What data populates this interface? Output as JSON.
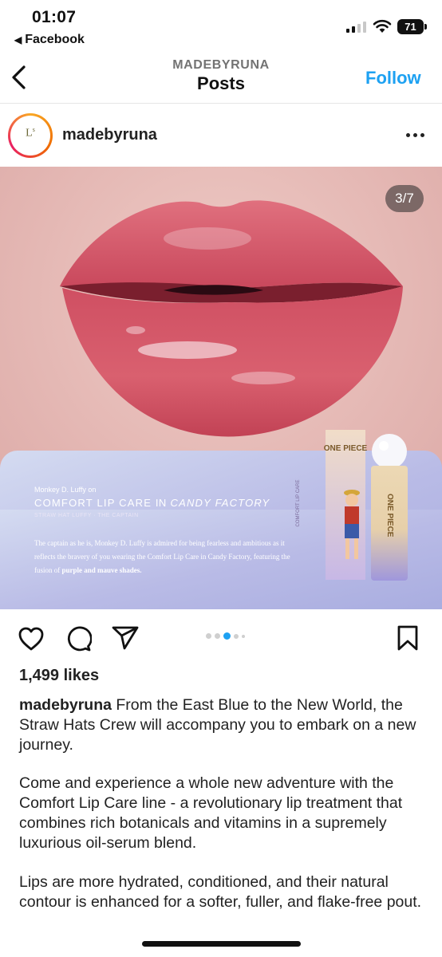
{
  "status_bar": {
    "time": "01:07",
    "back_app": "Facebook",
    "battery": "71"
  },
  "header": {
    "username": "MADEBYRUNA",
    "title": "Posts",
    "follow_label": "Follow"
  },
  "post": {
    "username": "madebyruna",
    "slide_counter": "3/7",
    "carousel": {
      "total_dots": 5,
      "active_index": 2
    },
    "likes": "1,499 likes"
  },
  "promo": {
    "name": "Monkey D. Luffy on",
    "title_prefix": "COMFORT LIP CARE",
    "title_in": "IN",
    "title_suffix": "CANDY FACTORY",
    "subtitle": "STRAW HAT LUFFY · THE CAPTAIN",
    "desc_main": "The captain as he is, Monkey D. Luffy is admired for being fearless and ambitious as it reflects the bravery of you wearing the Comfort Lip Care in Candy Factory, featuring the fusion of",
    "desc_emph": "purple and mauve shades.",
    "box_brand": "ONE PIECE",
    "box_vertical": "COMFORT LIP CARE",
    "brand_mark": "Lˢ"
  },
  "caption": {
    "username": "madebyruna",
    "p1": " From the East Blue to the New World, the Straw Hats Crew will accompany you to embark on a new journey.",
    "p2": "Come and experience a whole new adventure with the Comfort Lip Care line - a revolutionary lip treatment that combines rich botanicals and vitamins in a supremely luxurious oil-serum blend.",
    "p3": "Lips are more hydrated, conditioned, and their natural contour is enhanced for a softer, fuller, and flake-free pout."
  },
  "colors": {
    "follow_blue": "#1da1f2",
    "lip_red": "#c8465a",
    "skin": "#e8bcb8",
    "promo_lavender": "#b7b8e4"
  },
  "icons": [
    "back-chevron-icon",
    "signal-icon",
    "wifi-icon",
    "battery-icon",
    "more-icon",
    "heart-icon",
    "comment-icon",
    "share-icon",
    "bookmark-icon"
  ]
}
